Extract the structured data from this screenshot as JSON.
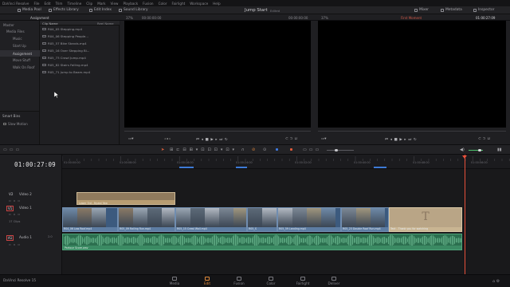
{
  "menu": [
    "DaVinci Resolve",
    "File",
    "Edit",
    "Trim",
    "Timeline",
    "Clip",
    "Mark",
    "View",
    "Playback",
    "Fusion",
    "Color",
    "Fairlight",
    "Workspace",
    "Help"
  ],
  "toolbar": {
    "media_pool": "Media Pool",
    "effects_library": "Effects Library",
    "edit_index": "Edit Index",
    "sound_library": "Sound Library",
    "project_title": "Jump Start",
    "project_status": "Edited",
    "mixer": "Mixer",
    "metadata": "Metadata",
    "inspector": "Inspector"
  },
  "subbar": {
    "bin_name": "Assignment",
    "source_zoom": "37%",
    "source_tc": "00:00:00:00",
    "source_duration": "00:00:00:00",
    "timeline_zoom": "37%",
    "timeline_name": "First Moment",
    "timeline_tc": "01:00:27:09"
  },
  "bins": {
    "items": [
      "Master",
      "Media Files",
      "Music",
      "Start Up",
      "Assignment",
      "Move Stuff",
      "Walk On Roof"
    ],
    "smart_bins_label": "Smart Bins",
    "smart_items": [
      "Slow Motion"
    ]
  },
  "clip_list": {
    "col_name": "Clip Name",
    "col_reel": "Reel Name",
    "clips": [
      "R04_05 Stepping.mp4",
      "R04_06 Stepping People...",
      "R05_57 Bike Stands.mp4",
      "R05_16 Over Stepping Bi...",
      "R05_73 Crawl Jump.mp4",
      "R05_82 Stairs Falling.mp4",
      "R05_71 Jump to Beam.mp4"
    ]
  },
  "source_viewer": {
    "tc": "00:00:00:00"
  },
  "timeline_viewer": {
    "tc": "01:00:27:09"
  },
  "timeline": {
    "timecode": "01:00:27:09",
    "ruler_ticks": [
      "01:00:00:00",
      "01:00:08:00",
      "01:00:16:00",
      "01:00:24:00",
      "01:00:32:00",
      "01:00:40:00",
      "01:00:48:00",
      "01:00:56:00"
    ],
    "tracks": [
      {
        "id": "V2",
        "name": "Video 2",
        "clips": "",
        "info": ""
      },
      {
        "id": "V1",
        "name": "Video 1",
        "clips": "17 Clips",
        "info": ""
      },
      {
        "id": "A1",
        "name": "Audio 1",
        "clips": "2.0",
        "info": ""
      }
    ],
    "v2_clip": "Lower 3rd - Nyawi Yaw",
    "v1_clips": [
      "R04_06 Low Roof.mp4",
      "R05_09 Railing Run.mp4",
      "R05_15 Crawl Wall.mp4",
      "R05_S",
      "R05_59 Landing.mp4",
      "R05_23 Double Roof Run.mp4",
      "Text - Thank you for watching"
    ],
    "a1_clip": "Parkour Score.wav",
    "text_clip_letter": "T"
  },
  "pages": [
    "Media",
    "Edit",
    "Fusion",
    "Color",
    "Fairlight",
    "Deliver"
  ],
  "active_page": "Edit",
  "app_name": "DaVinci Resolve 15",
  "colors": {
    "accent": "#e08a3a",
    "video_clip": "#3c5a7e",
    "audio_clip": "#2f7a55",
    "playhead": "#e8503a"
  }
}
